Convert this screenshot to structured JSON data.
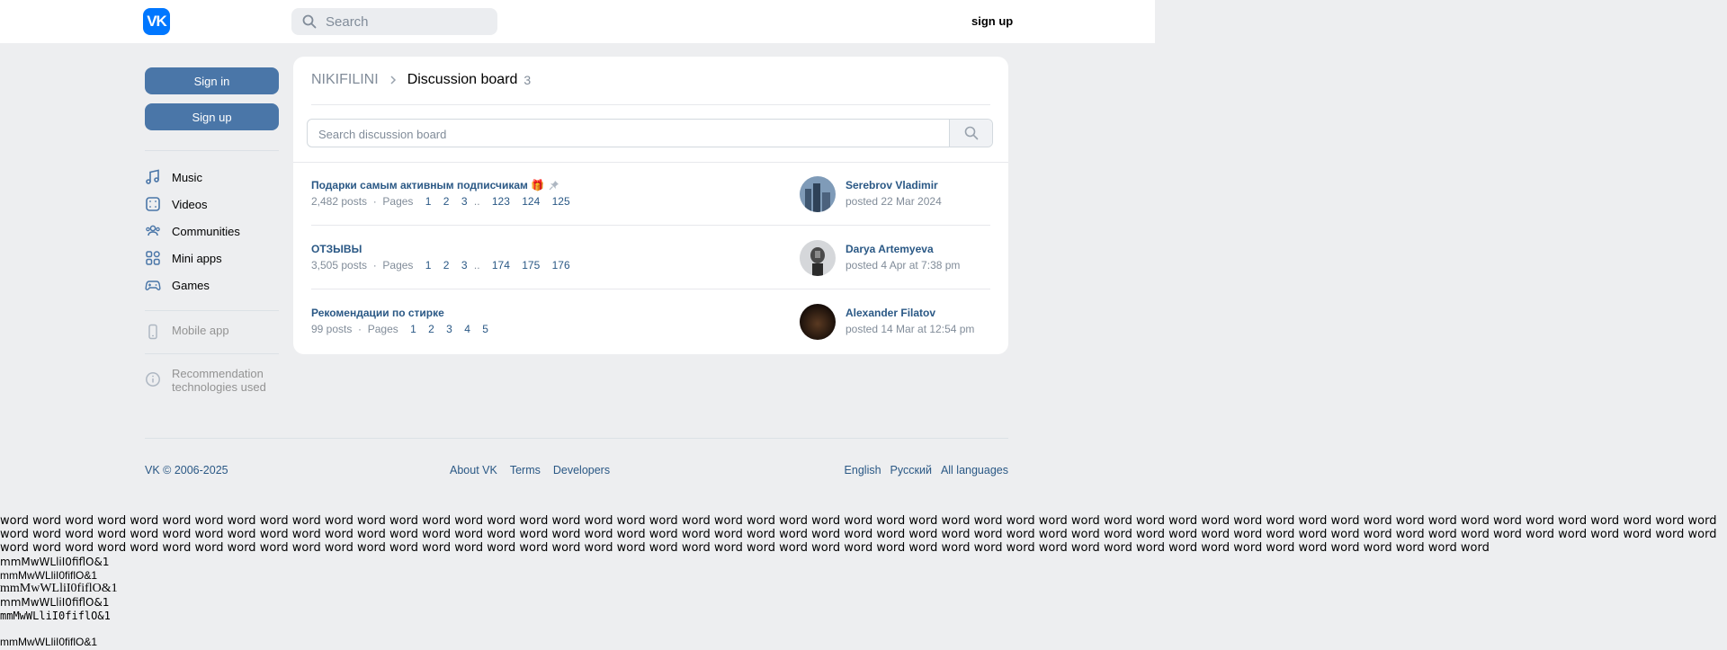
{
  "header": {
    "search_placeholder": "Search",
    "signup": "sign up",
    "logo_text": "VK"
  },
  "sidebar": {
    "signin": "Sign in",
    "signup": "Sign up",
    "items": [
      {
        "label": "Music",
        "icon": "music-icon"
      },
      {
        "label": "Videos",
        "icon": "video-icon"
      },
      {
        "label": "Communities",
        "icon": "communities-icon"
      },
      {
        "label": "Mini apps",
        "icon": "mini-apps-icon"
      },
      {
        "label": "Games",
        "icon": "gamepad-icon"
      }
    ],
    "mobile_app": "Mobile app",
    "recommendation_line1": "Recommendation",
    "recommendation_line2": "technologies used"
  },
  "board": {
    "breadcrumb_group": "NIKIFILINI",
    "breadcrumb_title": "Discussion board",
    "count": "3",
    "search_placeholder": "Search discussion board",
    "pages_label": "Pages",
    "topics": [
      {
        "title": "Подарки самым активным подписчикам 🎁",
        "posts": "2,482 posts",
        "pages": [
          "1",
          "2",
          "3",
          "123",
          "124",
          "125"
        ],
        "author": "Serebrov Vladimir",
        "posted": "posted 22 Mar 2024"
      },
      {
        "title": "ОТЗЫВЫ",
        "posts": "3,505 posts",
        "pages": [
          "1",
          "2",
          "3",
          "174",
          "175",
          "176"
        ],
        "author": "Darya Artemyeva",
        "posted": "posted 4 Apr at 7:38 pm"
      },
      {
        "title": "Рекомендации по стирке",
        "posts": "99 posts",
        "pages": [
          "1",
          "2",
          "3",
          "4",
          "5"
        ],
        "author": "Alexander Filatov",
        "posted": "posted 14 Mar at 12:54 pm"
      }
    ]
  },
  "footer": {
    "copyright": "VK © 2006-2025",
    "links": [
      "About VK",
      "Terms",
      "Developers"
    ],
    "languages": [
      "English",
      "Русский",
      "All languages"
    ]
  },
  "font_test": {
    "words_line": "word word word word word word word word word word word word word word word word word word word word word word word word word word word word word word word word word word word word word word word word word word word word word word word word word word word word word word word word word word word word word word word word word word word word word word word word word word word word word word word word word word word word word word word word word word word word word word word word word word word word word word word word word word word word word word word word word word word word word word word word word word word word word word word word word word word word word word word word word word word word word word word word word word word word word word word word",
    "sample": "mmMwWLliI0fiflO&1"
  }
}
